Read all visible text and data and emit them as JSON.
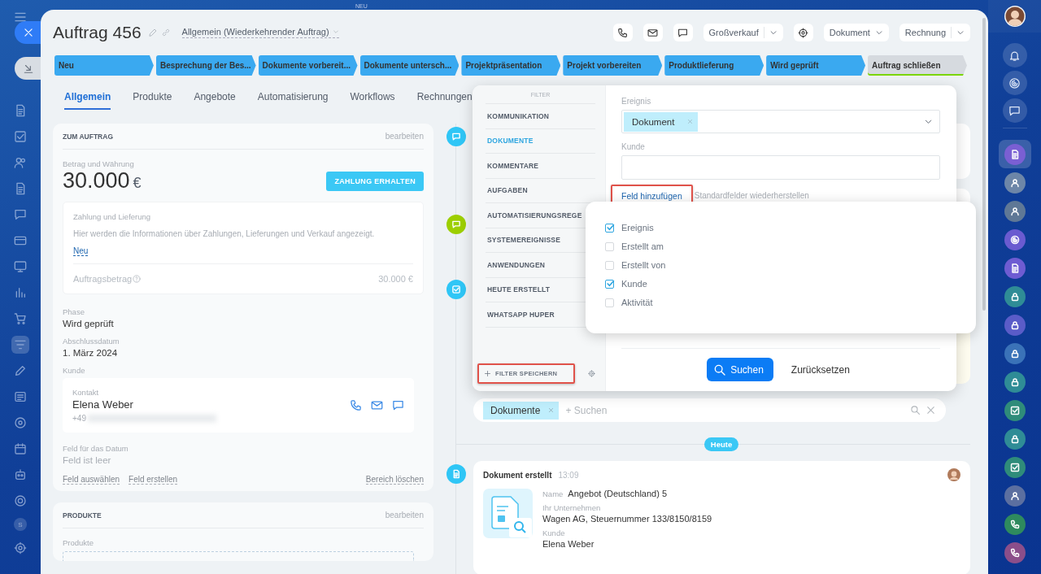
{
  "background": {
    "label": "NEU"
  },
  "left_sidebar": {
    "items": [
      {
        "kind": "menu",
        "selected": false
      },
      {
        "kind": "doc",
        "selected": false
      },
      {
        "kind": "check",
        "selected": false
      },
      {
        "kind": "people",
        "selected": false
      },
      {
        "kind": "doc",
        "selected": false
      },
      {
        "kind": "chat",
        "selected": false
      },
      {
        "kind": "card",
        "selected": false
      },
      {
        "kind": "screen",
        "selected": false
      },
      {
        "kind": "chart",
        "selected": false
      },
      {
        "kind": "cart",
        "selected": false
      },
      {
        "kind": "filter",
        "selected": true
      },
      {
        "kind": "pencil",
        "selected": false
      },
      {
        "kind": "news",
        "selected": false
      },
      {
        "kind": "disk",
        "selected": false
      },
      {
        "kind": "calendar",
        "selected": false
      },
      {
        "kind": "robot",
        "selected": false
      },
      {
        "kind": "target",
        "selected": false
      },
      {
        "kind": "letter",
        "text": "S",
        "selected": false
      },
      {
        "kind": "gear",
        "selected": false
      }
    ]
  },
  "header": {
    "title": "Auftrag 456",
    "category": "Allgemein (Wiederkehrender Auftrag)",
    "toolbar": [
      {
        "kind": "phone"
      },
      {
        "kind": "mail"
      },
      {
        "kind": "chat"
      },
      {
        "kind": "split",
        "label": "Großverkauf"
      },
      {
        "kind": "gear"
      },
      {
        "kind": "dropdown",
        "label": "Dokument"
      },
      {
        "kind": "split",
        "label": "Rechnung"
      }
    ]
  },
  "stages": [
    {
      "label": "Neu",
      "done": true,
      "kind": "progress"
    },
    {
      "label": "Besprechung der Bes...",
      "done": true,
      "kind": "progress"
    },
    {
      "label": "Dokumente vorbereit...",
      "done": true,
      "kind": "progress"
    },
    {
      "label": "Dokumente untersch...",
      "done": true,
      "kind": "progress"
    },
    {
      "label": "Projektpräsentation",
      "done": true,
      "kind": "progress"
    },
    {
      "label": "Projekt vorbereiten",
      "done": true,
      "kind": "progress"
    },
    {
      "label": "Produktlieferung",
      "done": true,
      "kind": "progress"
    },
    {
      "label": "Wird geprüft",
      "done": true,
      "kind": "progress"
    },
    {
      "label": "Auftrag schließen",
      "done": false,
      "kind": "success"
    }
  ],
  "tabs": [
    {
      "label": "Allgemein",
      "selected": true
    },
    {
      "label": "Produkte",
      "selected": false
    },
    {
      "label": "Angebote",
      "selected": false
    },
    {
      "label": "Automatisierung",
      "selected": false
    },
    {
      "label": "Workflows",
      "selected": false
    },
    {
      "label": "Rechnungen",
      "selected": false
    }
  ],
  "order_card": {
    "title": "ZUM AUFTRAG",
    "edit": "bearbeiten",
    "amount_label": "Betrag und Währung",
    "amount": "30.000",
    "currency": "€",
    "pay_button": "ZAHLUNG ERHALTEN",
    "payment_box": {
      "title": "Zahlung und Lieferung",
      "text": "Hier werden die Informationen über Zahlungen, Lieferungen und Verkauf angezeigt.",
      "link": "Neu",
      "total_label": "Auftragsbetrag",
      "total": "30.000 €"
    },
    "fields": [
      {
        "label": "Phase",
        "value": "Wird geprüft"
      },
      {
        "label": "Abschlussdatum",
        "value": "1. März 2024"
      }
    ],
    "customer": {
      "label": "Kunde",
      "type": "Kontakt",
      "name": "Elena Weber",
      "phone": "+49"
    },
    "date_field": {
      "label": "Feld für das Datum",
      "value": "Feld ist leer"
    },
    "actions": [
      "Feld auswählen",
      "Feld erstellen"
    ],
    "remove": "Bereich löschen"
  },
  "products_card": {
    "title": "PRODUKTE",
    "edit": "bearbeiten",
    "label": "Produkte"
  },
  "timeline": {
    "entries": [
      {
        "kind": "chat",
        "color": "#2fc6f6"
      },
      {
        "kind": "chat",
        "color": "#9dcf00"
      },
      {
        "kind": "task",
        "color": "#2fc6f6"
      }
    ],
    "search": {
      "tag": "Dokumente",
      "placeholder": "+ Suchen"
    },
    "day": "Heute",
    "document": {
      "color": "#2fc6f6",
      "title": "Dokument erstellt",
      "time": "13:09",
      "fields": [
        {
          "label": "Name",
          "value": "Angebot (Deutschland) 5",
          "inline": true
        },
        {
          "label": "Ihr Unternehmen",
          "value": "Wagen AG, Steuernummer 133/8150/8159",
          "inline": false
        },
        {
          "label": "Kunde",
          "value": "Elena Weber",
          "inline": false
        }
      ]
    }
  },
  "filter": {
    "heading": "FILTER",
    "presets": [
      {
        "label": "KOMMUNIKATION",
        "selected": false
      },
      {
        "label": "DOKUMENTE",
        "selected": true
      },
      {
        "label": "KOMMENTARE",
        "selected": false
      },
      {
        "label": "AUFGABEN",
        "selected": false
      },
      {
        "label": "AUTOMATISIERUNGSREGE",
        "selected": false
      },
      {
        "label": "SYSTEMEREIGNISSE",
        "selected": false
      },
      {
        "label": "ANWENDUNGEN",
        "selected": false
      },
      {
        "label": "HEUTE ERSTELLT",
        "selected": false
      },
      {
        "label": "WHATSAPP HUPER",
        "selected": false
      }
    ],
    "save": {
      "label": "FILTER SPEICHERN",
      "highlighted": true
    },
    "fields": [
      {
        "label": "Ereignis",
        "kind": "tags",
        "tags": [
          "Dokument"
        ]
      },
      {
        "label": "Kunde",
        "kind": "text"
      }
    ],
    "add_field": {
      "label": "Feld hinzufügen",
      "highlighted": true
    },
    "restore": "Standardfelder wiederherstellen",
    "search_button": "Suchen",
    "reset": "Zurücksetzen",
    "field_menu": [
      {
        "label": "Ereignis",
        "checked": true
      },
      {
        "label": "Erstellt am",
        "checked": false
      },
      {
        "label": "Erstellt von",
        "checked": false
      },
      {
        "label": "Kunde",
        "checked": true
      },
      {
        "label": "Aktivität",
        "checked": false
      }
    ]
  },
  "right_rail": {
    "top": [
      {
        "kind": "bell"
      },
      {
        "kind": "spiral"
      },
      {
        "kind": "chat"
      }
    ],
    "items": [
      {
        "kind": "doc",
        "color": "#7a5fd3",
        "selected": true
      },
      {
        "kind": "person",
        "color": "#6d86a8",
        "selected": false
      },
      {
        "kind": "person",
        "color": "#5f7896",
        "selected": false
      },
      {
        "kind": "spiral",
        "color": "#6a5bd0",
        "selected": false
      },
      {
        "kind": "doc",
        "color": "#6e5cd2",
        "selected": false
      },
      {
        "kind": "lock",
        "color": "#2f8c96",
        "selected": false
      },
      {
        "kind": "lock",
        "color": "#5a5cc8",
        "selected": false
      },
      {
        "kind": "lock",
        "color": "#3a72b8",
        "selected": false
      },
      {
        "kind": "lock",
        "color": "#2f8c96",
        "selected": false
      },
      {
        "kind": "check",
        "color": "#2f8c7a",
        "selected": false
      },
      {
        "kind": "lock",
        "color": "#2f8c96",
        "selected": false
      },
      {
        "kind": "check",
        "color": "#2f8c7a",
        "selected": false
      },
      {
        "kind": "person",
        "color": "#5c6fa0",
        "selected": false
      },
      {
        "kind": "phone",
        "color": "#2e8a5e",
        "selected": false
      },
      {
        "kind": "phone",
        "color": "#8b4e8a",
        "selected": false
      }
    ]
  }
}
